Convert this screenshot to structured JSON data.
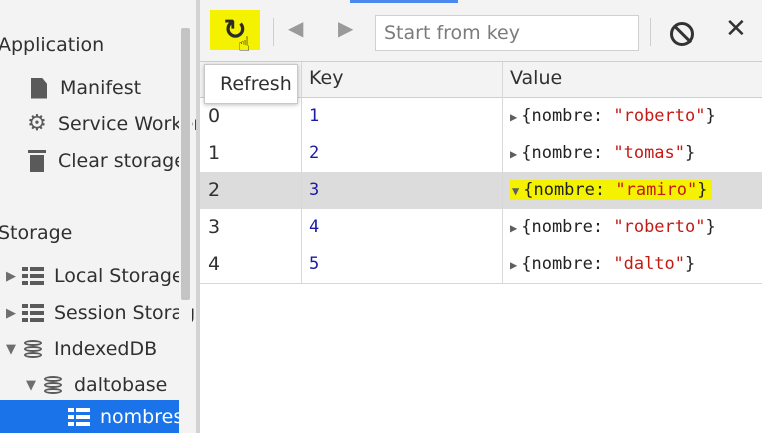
{
  "sidebar": {
    "application_heading": "Application",
    "application_items": [
      {
        "label": "Manifest",
        "icon": "document-icon"
      },
      {
        "label": "Service Workers",
        "icon": "gear-icon"
      },
      {
        "label": "Clear storage",
        "icon": "trash-icon"
      }
    ],
    "storage_heading": "Storage",
    "storage_items": [
      {
        "label": "Local Storage",
        "icon": "grid-icon",
        "expanded": false
      },
      {
        "label": "Session Storage",
        "icon": "grid-icon",
        "expanded": false
      },
      {
        "label": "IndexedDB",
        "icon": "database-icon",
        "expanded": true
      },
      {
        "label": "daltobase",
        "icon": "database-icon",
        "expanded": true
      },
      {
        "label": "nombres",
        "icon": "grid-icon",
        "selected": true
      }
    ]
  },
  "toolbar": {
    "refresh_tooltip": "Refresh",
    "search": {
      "placeholder": "Start from key",
      "value": ""
    },
    "icons": {
      "refresh": "refresh-icon",
      "previous": "previous-page-icon",
      "next": "next-page-icon",
      "clear": "clear-object-store-icon",
      "delete": "delete-selected-icon"
    }
  },
  "table": {
    "columns": [
      "#",
      "Key",
      "Value"
    ],
    "rows": [
      {
        "index": "0",
        "key": "1",
        "value_prefix": "{nombre: ",
        "value_string": "\"roberto\"",
        "value_suffix": "}",
        "highlighted": false
      },
      {
        "index": "1",
        "key": "2",
        "value_prefix": "{nombre: ",
        "value_string": "\"tomas\"",
        "value_suffix": "}",
        "highlighted": false
      },
      {
        "index": "2",
        "key": "3",
        "value_prefix": "{nombre: ",
        "value_string": "\"ramiro\"",
        "value_suffix": "}",
        "highlighted": true
      },
      {
        "index": "3",
        "key": "4",
        "value_prefix": "{nombre: ",
        "value_string": "\"roberto\"",
        "value_suffix": "}",
        "highlighted": false
      },
      {
        "index": "4",
        "key": "5",
        "value_prefix": "{nombre: ",
        "value_string": "\"dalto\"",
        "value_suffix": "}",
        "highlighted": false
      }
    ]
  },
  "colors": {
    "highlighter": "#f4f200",
    "selection": "#1a73e8",
    "key_number": "#1a1aa6",
    "string_value": "#c41a16"
  }
}
